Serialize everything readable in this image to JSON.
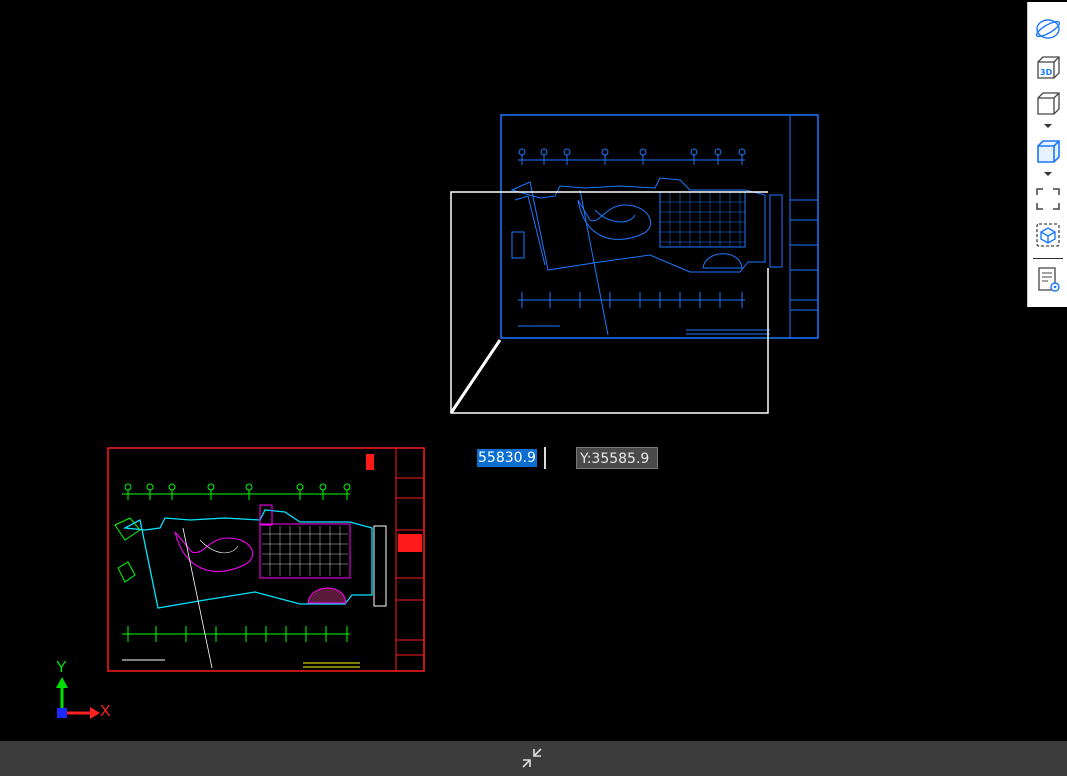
{
  "coordinates": {
    "x_value": "55830.9",
    "y_value": "Y:35585.9"
  },
  "ucs": {
    "x_label": "X",
    "y_label": "Y"
  },
  "toolbar": {
    "items": [
      {
        "name": "orbit",
        "icon": "orbit-icon"
      },
      {
        "name": "3d-view",
        "icon": "3d-box-icon",
        "text": "3D"
      },
      {
        "name": "view-cube",
        "icon": "cube-icon"
      },
      {
        "name": "visual-style",
        "icon": "cube-shaded-icon"
      },
      {
        "name": "full-screen",
        "icon": "fullscreen-icon"
      },
      {
        "name": "isolate",
        "icon": "isolate-box-icon"
      },
      {
        "name": "properties",
        "icon": "list-view-icon"
      }
    ]
  },
  "colors": {
    "background": "#000000",
    "blue_drawing": "#1a78ff",
    "red_frame": "#ff1a1a",
    "green_grid": "#00ff00",
    "magenta": "#ff00ff",
    "cyan": "#00e5ff",
    "status_bar": "#3c3c3c",
    "selection_blue": "#0a6fd1"
  },
  "status_bar": {
    "collapse_icon": "collapse-arrows-icon"
  }
}
